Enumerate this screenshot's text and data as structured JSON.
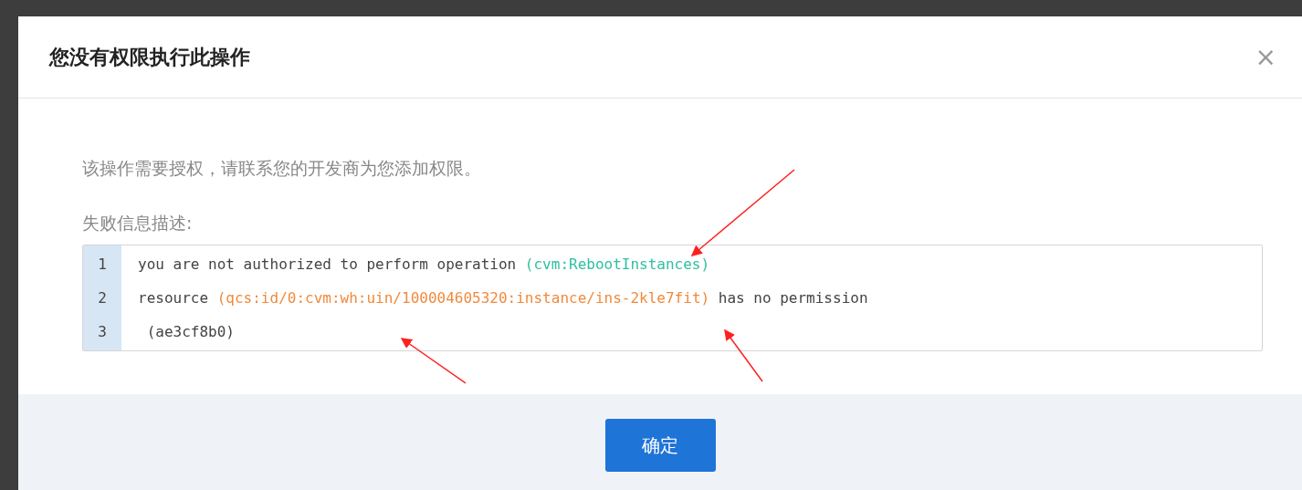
{
  "dialog": {
    "title": "您没有权限执行此操作",
    "close": "×",
    "message": "该操作需要授权，请联系您的开发商为您添加权限。",
    "details_label": "失败信息描述:",
    "code_lines": [
      {
        "number": "1",
        "segments": [
          {
            "kind": "plain",
            "text": "you are not authorized to perform operation "
          },
          {
            "kind": "action",
            "text": "(cvm:RebootInstances)"
          }
        ]
      },
      {
        "number": "2",
        "segments": [
          {
            "kind": "plain",
            "text": "resource "
          },
          {
            "kind": "resource",
            "text": "(qcs:id/0:cvm:wh:uin/100004605320:instance/ins-2kle7fit)"
          },
          {
            "kind": "plain",
            "text": " has no permission"
          }
        ]
      },
      {
        "number": "3",
        "segments": [
          {
            "kind": "plain",
            "text": " (ae3cf8b0)"
          }
        ]
      }
    ],
    "confirm_button": "确定"
  }
}
